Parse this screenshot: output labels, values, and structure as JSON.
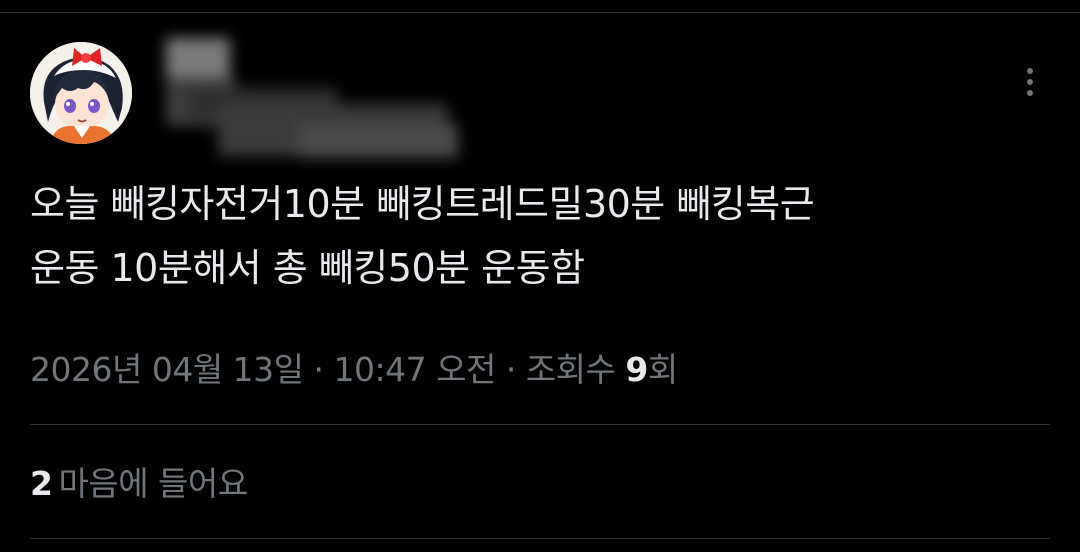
{
  "tweet": {
    "text_line1": "오늘 빼킹자전거10분 빼킹트레드밀30분 빼킹복근",
    "text_line2": "운동 10분해서 총 빼킹50분 운동함",
    "date": "2026년 04월 13일",
    "separator": " · ",
    "time": "10:47 오전",
    "views_label": "조회수 ",
    "views_count": "9",
    "views_unit": "회",
    "likes_count": "2",
    "likes_label": "마음에 들어요"
  },
  "author": {
    "avatar_icon": "avatar-image",
    "name_obscured": true
  },
  "icons": {
    "more": "more-options-icon"
  },
  "colors": {
    "background": "#000000",
    "text_primary": "#e7e9ea",
    "text_secondary": "#71767b",
    "divider": "#2f3336"
  }
}
